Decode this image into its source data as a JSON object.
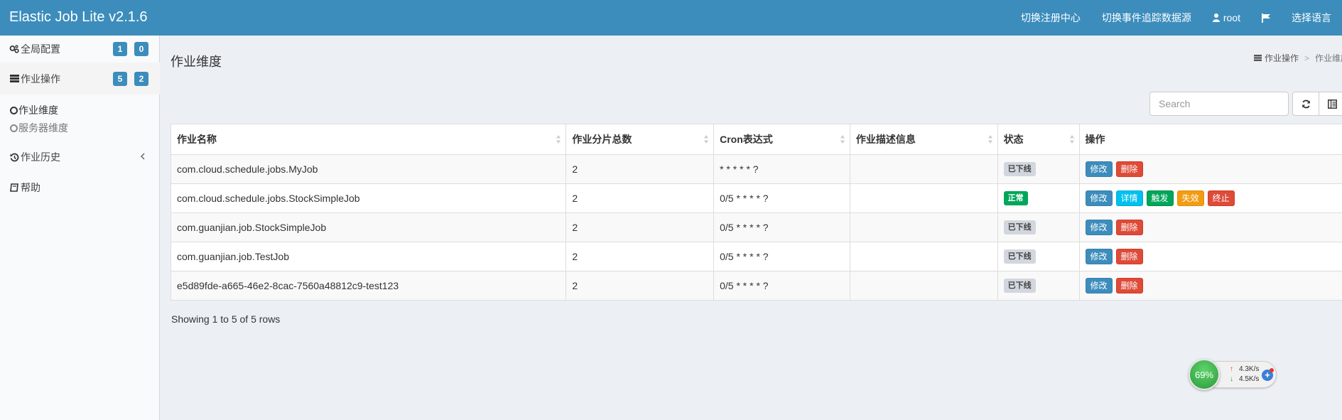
{
  "header": {
    "title": "Elastic Job Lite v2.1.6",
    "nav": {
      "registry_center": "切换注册中心",
      "event_trace_source": "切换事件追踪数据源",
      "user": "root",
      "language": "选择语言"
    }
  },
  "sidebar": {
    "global_config": {
      "label": "全局配置",
      "badges": [
        "1",
        "0"
      ]
    },
    "job_operation": {
      "label": "作业操作",
      "badges": [
        "5",
        "2"
      ]
    },
    "job_dimension": "作业维度",
    "server_dimension": "服务器维度",
    "job_history": "作业历史",
    "help": "帮助"
  },
  "main": {
    "title": "作业维度",
    "breadcrumb": [
      "作业操作",
      "作业维度"
    ],
    "search_placeholder": "Search",
    "pagination_info": "Showing 1 to 5 of 5 rows"
  },
  "table": {
    "headers": [
      "作业名称",
      "作业分片总数",
      "Cron表达式",
      "作业描述信息",
      "状态",
      "操作"
    ],
    "rows": [
      {
        "name": "com.cloud.schedule.jobs.MyJob",
        "shards": "2",
        "cron": "* * * * * ?",
        "desc": "",
        "status": "已下线",
        "status_type": "offline"
      },
      {
        "name": "com.cloud.schedule.jobs.StockSimpleJob",
        "shards": "2",
        "cron": "0/5 * * * * ?",
        "desc": "",
        "status": "正常",
        "status_type": "normal"
      },
      {
        "name": "com.guanjian.job.StockSimpleJob",
        "shards": "2",
        "cron": "0/5 * * * * ?",
        "desc": "",
        "status": "已下线",
        "status_type": "offline"
      },
      {
        "name": "com.guanjian.job.TestJob",
        "shards": "2",
        "cron": "0/5 * * * * ?",
        "desc": "",
        "status": "已下线",
        "status_type": "offline"
      },
      {
        "name": "e5d89fde-a665-46e2-8cac-7560a48812c9-test123",
        "shards": "2",
        "cron": "0/5 * * * * ?",
        "desc": "",
        "status": "已下线",
        "status_type": "offline"
      }
    ]
  },
  "buttons": {
    "modify": "修改",
    "delete": "删除",
    "detail": "详情",
    "trigger": "触发",
    "disable": "失效",
    "shutdown": "终止"
  },
  "netmon": {
    "percent": "69%",
    "upload": "4.3K/s",
    "download": "4.5K/s"
  },
  "colors": {
    "header": "#3c8dbc",
    "primary": "#3c8dbc",
    "danger": "#dd4b39",
    "info": "#00c0ef",
    "success": "#00a65a",
    "warning": "#f39c12"
  }
}
